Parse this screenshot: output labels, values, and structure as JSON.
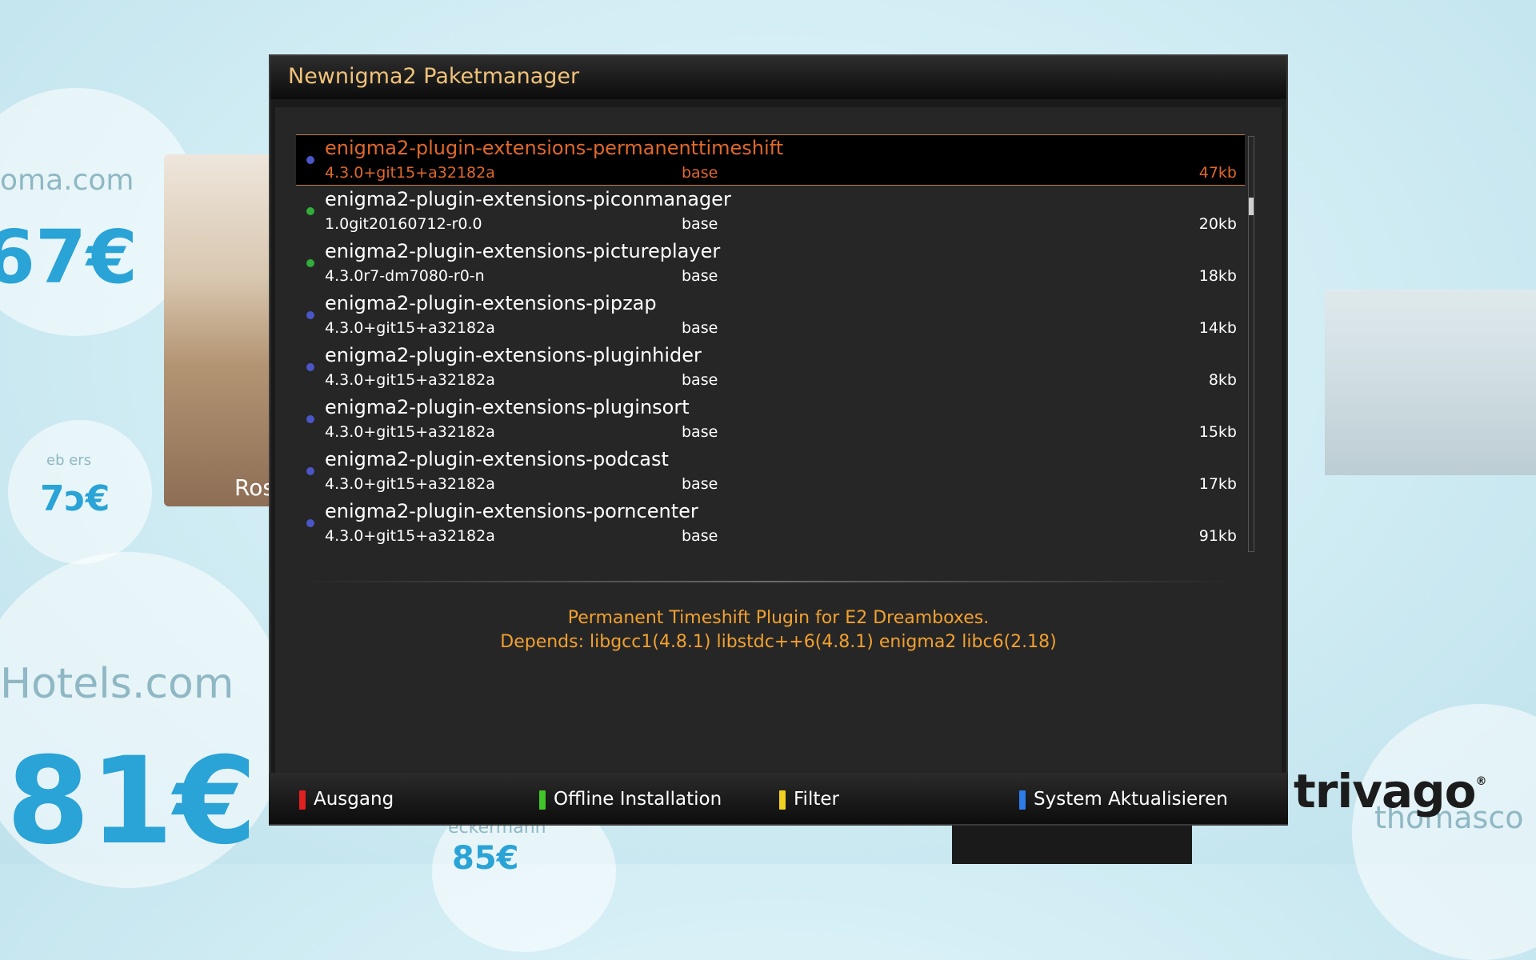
{
  "window": {
    "title": "Newnigma2 Paketmanager"
  },
  "packages": [
    {
      "name": "enigma2-plugin-extensions-permanenttimeshift",
      "version": "4.3.0+git15+a32182a",
      "section": "base",
      "size": "47kb",
      "status_color": "#4a56c8",
      "selected": true
    },
    {
      "name": "enigma2-plugin-extensions-piconmanager",
      "version": "1.0git20160712-r0.0",
      "section": "base",
      "size": "20kb",
      "status_color": "#2fae3a",
      "selected": false
    },
    {
      "name": "enigma2-plugin-extensions-pictureplayer",
      "version": "4.3.0r7-dm7080-r0-n",
      "section": "base",
      "size": "18kb",
      "status_color": "#2fae3a",
      "selected": false
    },
    {
      "name": "enigma2-plugin-extensions-pipzap",
      "version": "4.3.0+git15+a32182a",
      "section": "base",
      "size": "14kb",
      "status_color": "#4a56c8",
      "selected": false
    },
    {
      "name": "enigma2-plugin-extensions-pluginhider",
      "version": "4.3.0+git15+a32182a",
      "section": "base",
      "size": "8kb",
      "status_color": "#4a56c8",
      "selected": false
    },
    {
      "name": "enigma2-plugin-extensions-pluginsort",
      "version": "4.3.0+git15+a32182a",
      "section": "base",
      "size": "15kb",
      "status_color": "#4a56c8",
      "selected": false
    },
    {
      "name": "enigma2-plugin-extensions-podcast",
      "version": "4.3.0+git15+a32182a",
      "section": "base",
      "size": "17kb",
      "status_color": "#4a56c8",
      "selected": false
    },
    {
      "name": "enigma2-plugin-extensions-porncenter",
      "version": "4.3.0+git15+a32182a",
      "section": "base",
      "size": "91kb",
      "status_color": "#4a56c8",
      "selected": false
    }
  ],
  "description": {
    "line1": "Permanent Timeshift Plugin for E2 Dreamboxes.",
    "line2": "Depends: libgcc1(4.8.1) libstdc++6(4.8.1) enigma2 libc6(2.18)"
  },
  "buttons": [
    {
      "label": "Ausgang",
      "color": "#e02020"
    },
    {
      "label": "Offline Installation",
      "color": "#3fc52a"
    },
    {
      "label": "Filter",
      "color": "#f0d020"
    },
    {
      "label": "System Aktualisieren",
      "color": "#2d7ce8"
    }
  ],
  "background": {
    "texts": [
      "oma.com",
      "67€",
      "eb    ers",
      "7ɔ€",
      "Hotels.com",
      "81€",
      "thomasco",
      "Ros",
      "eckermann",
      "85€"
    ],
    "logo": "trivago"
  }
}
